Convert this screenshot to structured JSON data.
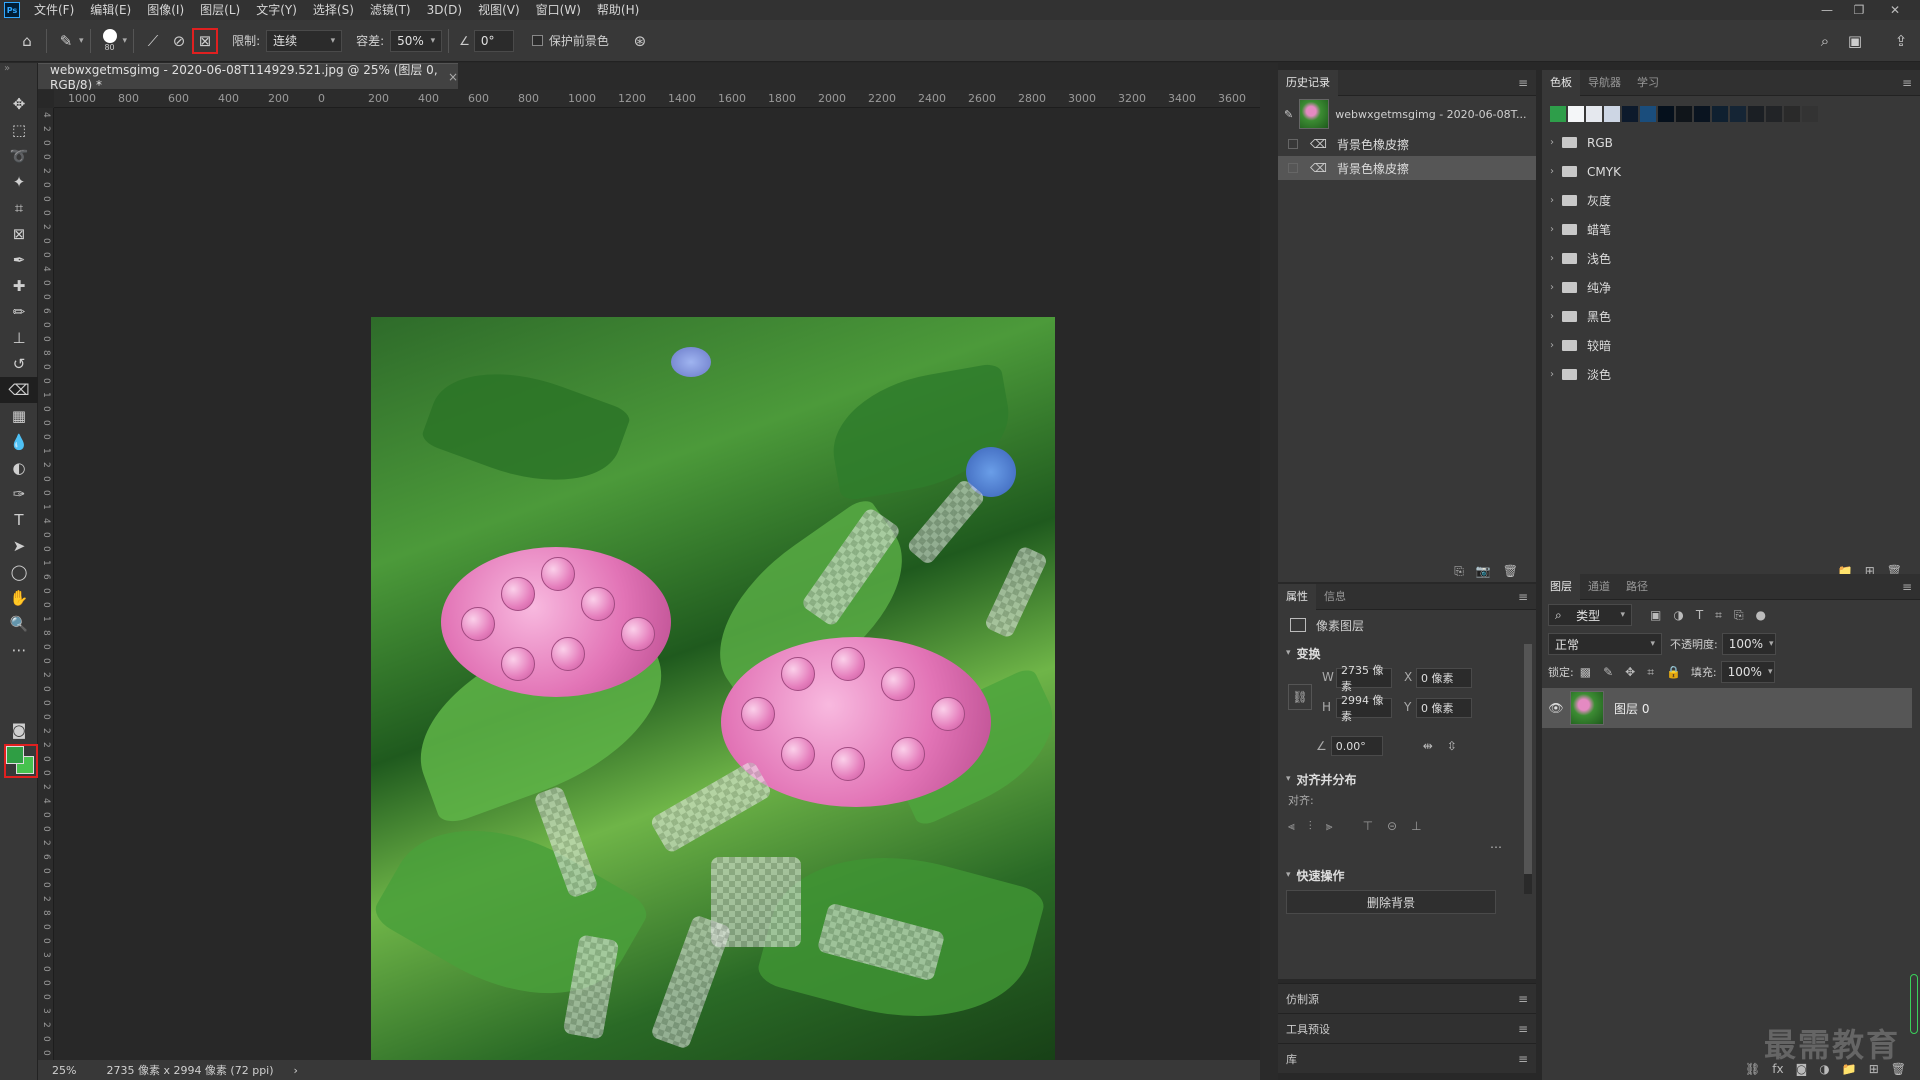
{
  "app": {
    "logo": "Ps"
  },
  "menu": [
    "文件(F)",
    "编辑(E)",
    "图像(I)",
    "图层(L)",
    "文字(Y)",
    "选择(S)",
    "滤镜(T)",
    "3D(D)",
    "视图(V)",
    "窗口(W)",
    "帮助(H)"
  ],
  "window_controls": {
    "minimize": "—",
    "restore": "❐",
    "close": "✕"
  },
  "options": {
    "brush_size": "80",
    "limit_label": "限制:",
    "limit_value": "连续",
    "tolerance_label": "容差:",
    "tolerance_value": "50%",
    "angle_value": "0°",
    "protect_fg_label": "保护前景色"
  },
  "document": {
    "tab_title": "webwxgetmsgimg - 2020-06-08T114929.521.jpg @ 25% (图层 0, RGB/8) *",
    "close": "×",
    "zoom": "25%",
    "doc_info": "2735 像素 x 2994 像素 (72 ppi)",
    "status_arrow": "›"
  },
  "ruler_h": [
    "1000",
    "800",
    "600",
    "400",
    "200",
    "0",
    "200",
    "400",
    "600",
    "800",
    "1000",
    "1200",
    "1400",
    "1600",
    "1800",
    "2000",
    "2200",
    "2400",
    "2600",
    "2800",
    "3000",
    "3200",
    "3400",
    "3600"
  ],
  "ruler_v": [
    "4",
    "2",
    "0",
    "0",
    "2",
    "0",
    "0",
    "0",
    "2",
    "0",
    "0",
    "4",
    "0",
    "0",
    "6",
    "0",
    "0",
    "8",
    "0",
    "0",
    "1",
    "0",
    "0",
    "0",
    "1",
    "2",
    "0",
    "0",
    "1",
    "4",
    "0",
    "0",
    "1",
    "6",
    "0",
    "0",
    "1",
    "8",
    "0",
    "0",
    "2",
    "0",
    "0",
    "0",
    "2",
    "2",
    "0",
    "0",
    "2",
    "4",
    "0",
    "0",
    "2",
    "6",
    "0",
    "0",
    "2",
    "8",
    "0",
    "0",
    "3",
    "0",
    "0",
    "0",
    "3",
    "2",
    "0",
    "0"
  ],
  "history": {
    "tab": "历史记录",
    "snapshot": "webwxgetmsgimg - 2020-06-08T...",
    "steps": [
      "背景色橡皮擦",
      "背景色橡皮擦"
    ]
  },
  "swatches": {
    "tabs": [
      "色板",
      "导航器",
      "学习"
    ],
    "colors": [
      "#2e9e4a",
      "#f4f6f8",
      "#e5e8ee",
      "#cdd6e4",
      "#0d1a2c",
      "#1a4d7c",
      "#05101c",
      "#10151a",
      "#0a1420",
      "#0f2030",
      "#152535",
      "#1b1f24",
      "#222427",
      "#2a2a2a",
      "#333333"
    ],
    "groups": [
      "RGB",
      "CMYK",
      "灰度",
      "蜡笔",
      "浅色",
      "纯净",
      "黑色",
      "较暗",
      "淡色"
    ]
  },
  "properties": {
    "tabs": [
      "属性",
      "信息"
    ],
    "type": "像素图层",
    "transform_label": "变换",
    "w_label": "W",
    "w_value": "2735 像素",
    "x_label": "X",
    "x_value": "0 像素",
    "h_label": "H",
    "h_value": "2994 像素",
    "y_label": "Y",
    "y_value": "0 像素",
    "angle": "0.00°",
    "align_section": "对齐并分布",
    "align_label": "对齐:",
    "quick_section": "快速操作",
    "remove_bg": "删除背景"
  },
  "collapsed_panels": [
    "仿制源",
    "工具预设",
    "库"
  ],
  "layers": {
    "tabs": [
      "图层",
      "通道",
      "路径"
    ],
    "filter": "类型",
    "blend_mode": "正常",
    "opacity_label": "不透明度:",
    "opacity_value": "100%",
    "lock_label": "锁定:",
    "fill_label": "填充:",
    "fill_value": "100%",
    "layer_name": "图层 0"
  },
  "watermark": "最需教育"
}
